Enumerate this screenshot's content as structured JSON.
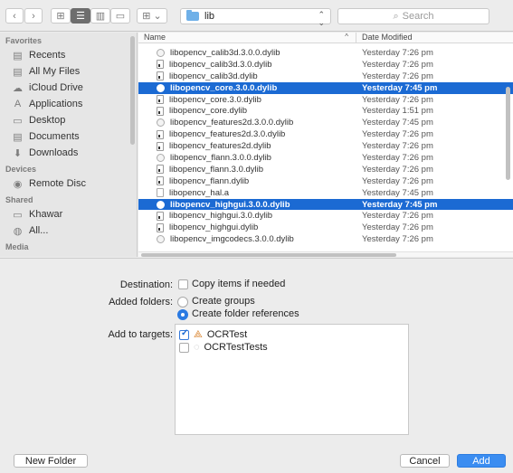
{
  "toolbar": {
    "back_glyph": "‹",
    "forward_glyph": "›",
    "view_icons": "⊞",
    "view_list": "☰",
    "view_columns": "▥",
    "view_coverflow": "▭",
    "arrange": "⊞ ⌄",
    "path": "lib",
    "search_placeholder": "Search",
    "search_glyph": "⌕"
  },
  "sidebar": {
    "sections": [
      {
        "title": "Favorites",
        "items": [
          {
            "label": "Recents",
            "icon": "clock-icon",
            "glyph": "▤"
          },
          {
            "label": "All My Files",
            "icon": "files-icon",
            "glyph": "▤"
          },
          {
            "label": "iCloud Drive",
            "icon": "cloud-icon",
            "glyph": "☁"
          },
          {
            "label": "Applications",
            "icon": "applications-icon",
            "glyph": "A"
          },
          {
            "label": "Desktop",
            "icon": "desktop-icon",
            "glyph": "▭"
          },
          {
            "label": "Documents",
            "icon": "documents-icon",
            "glyph": "▤"
          },
          {
            "label": "Downloads",
            "icon": "downloads-icon",
            "glyph": "⬇"
          }
        ]
      },
      {
        "title": "Devices",
        "items": [
          {
            "label": "Remote Disc",
            "icon": "disc-icon",
            "glyph": "◉"
          }
        ]
      },
      {
        "title": "Shared",
        "items": [
          {
            "label": "Khawar",
            "icon": "computer-icon",
            "glyph": "▭"
          },
          {
            "label": "All...",
            "icon": "network-icon",
            "glyph": "◍"
          }
        ]
      },
      {
        "title": "Media",
        "items": []
      }
    ]
  },
  "filelist": {
    "col_name": "Name",
    "col_date": "Date Modified",
    "sort_glyph": "^",
    "rows": [
      {
        "name": "libopencv_calib3d.3.0.0.dylib",
        "date": "Yesterday 7:26 pm",
        "icon": "alias",
        "selected": false
      },
      {
        "name": "libopencv_calib3d.3.0.dylib",
        "date": "Yesterday 7:26 pm",
        "icon": "exec",
        "selected": false
      },
      {
        "name": "libopencv_calib3d.dylib",
        "date": "Yesterday 7:26 pm",
        "icon": "exec",
        "selected": false
      },
      {
        "name": "libopencv_core.3.0.0.dylib",
        "date": "Yesterday 7:45 pm",
        "icon": "alias",
        "selected": true
      },
      {
        "name": "libopencv_core.3.0.dylib",
        "date": "Yesterday 7:26 pm",
        "icon": "exec",
        "selected": false
      },
      {
        "name": "libopencv_core.dylib",
        "date": "Yesterday 1:51 pm",
        "icon": "exec",
        "selected": false
      },
      {
        "name": "libopencv_features2d.3.0.0.dylib",
        "date": "Yesterday 7:45 pm",
        "icon": "alias",
        "selected": false
      },
      {
        "name": "libopencv_features2d.3.0.dylib",
        "date": "Yesterday 7:26 pm",
        "icon": "exec",
        "selected": false
      },
      {
        "name": "libopencv_features2d.dylib",
        "date": "Yesterday 7:26 pm",
        "icon": "exec",
        "selected": false
      },
      {
        "name": "libopencv_flann.3.0.0.dylib",
        "date": "Yesterday 7:26 pm",
        "icon": "alias",
        "selected": false
      },
      {
        "name": "libopencv_flann.3.0.dylib",
        "date": "Yesterday 7:26 pm",
        "icon": "exec",
        "selected": false
      },
      {
        "name": "libopencv_flann.dylib",
        "date": "Yesterday 7:26 pm",
        "icon": "exec",
        "selected": false
      },
      {
        "name": "libopencv_hal.a",
        "date": "Yesterday 7:45 pm",
        "icon": "plain",
        "selected": false
      },
      {
        "name": "libopencv_highgui.3.0.0.dylib",
        "date": "Yesterday 7:45 pm",
        "icon": "alias",
        "selected": true
      },
      {
        "name": "libopencv_highgui.3.0.dylib",
        "date": "Yesterday 7:26 pm",
        "icon": "exec",
        "selected": false
      },
      {
        "name": "libopencv_highgui.dylib",
        "date": "Yesterday 7:26 pm",
        "icon": "exec",
        "selected": false
      },
      {
        "name": "libopencv_imgcodecs.3.0.0.dylib",
        "date": "Yesterday 7:26 pm",
        "icon": "alias",
        "selected": false
      }
    ]
  },
  "options": {
    "destination_label": "Destination:",
    "copy_items": "Copy items if needed",
    "copy_checked": false,
    "added_folders_label": "Added folders:",
    "create_groups": "Create groups",
    "create_folder_refs": "Create folder references",
    "selected_folder_option": "folder_references",
    "targets_label": "Add to targets:",
    "targets": [
      {
        "name": "OCRTest",
        "checked": true,
        "icon": "app-target-icon"
      },
      {
        "name": "OCRTestTests",
        "checked": false,
        "icon": "test-target-icon"
      }
    ]
  },
  "footer": {
    "new_folder": "New Folder",
    "cancel": "Cancel",
    "add": "Add"
  },
  "colors": {
    "selection": "#1b6ad3",
    "primary_button": "#3b8df1"
  }
}
